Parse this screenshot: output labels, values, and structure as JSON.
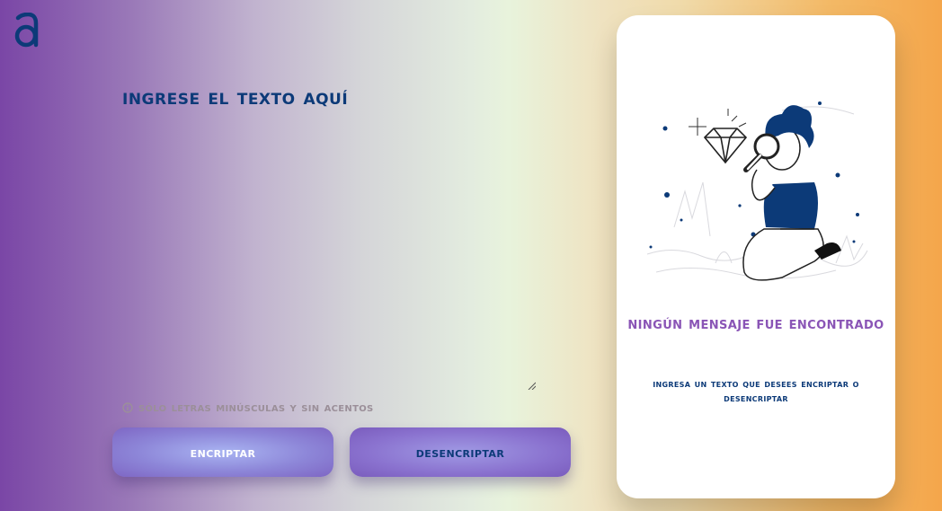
{
  "header": {
    "logo_icon": "alura-a-logo-icon"
  },
  "input": {
    "title": "Ingrese el texto aquí",
    "value": "",
    "hint_icon": "info-icon",
    "hint": "Sólo letras minúsculas y sin acentos"
  },
  "actions": {
    "encrypt_label": "Encriptar",
    "decrypt_label": "Desencriptar"
  },
  "output": {
    "illustration": "person-with-magnifying-glass-illustration",
    "title": "Ningún mensaje fue encontrado",
    "subtitle": "Ingresa un texto que desees encriptar o desencriptar"
  },
  "colors": {
    "primary": "#0c3a78",
    "accent_purple": "#8a55b6",
    "hint": "#9b8f99",
    "panel_bg": "#ffffff"
  }
}
